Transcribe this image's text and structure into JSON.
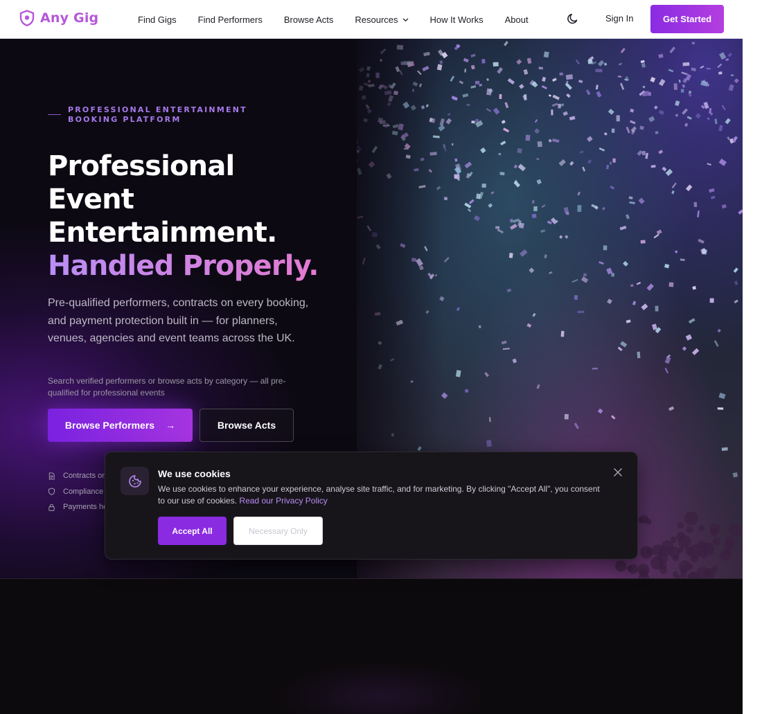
{
  "brand": {
    "name": "Any Gig",
    "accent": "#b657d8",
    "icon": "shield-icon"
  },
  "nav": {
    "links": [
      "Find Gigs",
      "Find Performers",
      "Browse Acts",
      "Resources",
      "How It Works",
      "About"
    ],
    "resources_icon": "chevron-down-icon",
    "theme_icon": "moon-icon",
    "sign_in": "Sign In",
    "get_started": "Get Started"
  },
  "hero": {
    "eyebrow": "PROFESSIONAL ENTERTAINMENT BOOKING PLATFORM",
    "headline_lines": [
      "Professional",
      "Event",
      "Entertainment."
    ],
    "headline_accent": "Handled Properly.",
    "subtext": "Pre-qualified performers, contracts on every booking, and payment protection built in — for planners, venues, agencies and event teams across the UK.",
    "search_hint": "Search verified performers or browse acts by category — all pre-qualified for professional events",
    "primary_button": "Browse Performers",
    "primary_button_icon": "arrow-right-icon",
    "secondary_button": "Browse Acts",
    "features": [
      {
        "icon": "document-icon",
        "label": "Contracts on"
      },
      {
        "icon": "shield-icon",
        "label": "Compliance"
      },
      {
        "icon": "lock-icon",
        "label": "Payments he"
      }
    ],
    "image": "confetti-concert-photo"
  },
  "cookie_banner": {
    "icon": "cookie-icon",
    "title": "We use cookies",
    "text": "We use cookies to enhance your experience, analyse site traffic, and for marketing. By clicking \"Accept All\", you consent to our use of cookies.",
    "link": "Read our Privacy Policy",
    "close_icon": "close-icon",
    "accept_button": "Accept All",
    "necessary_button": "Necessary Only"
  },
  "colors": {
    "primary": "#8a2be2",
    "hero_bg": "#0c0912",
    "eyebrow": "#a779e9",
    "gradient_start": "#b98ef5",
    "gradient_end": "#e37ad0"
  }
}
